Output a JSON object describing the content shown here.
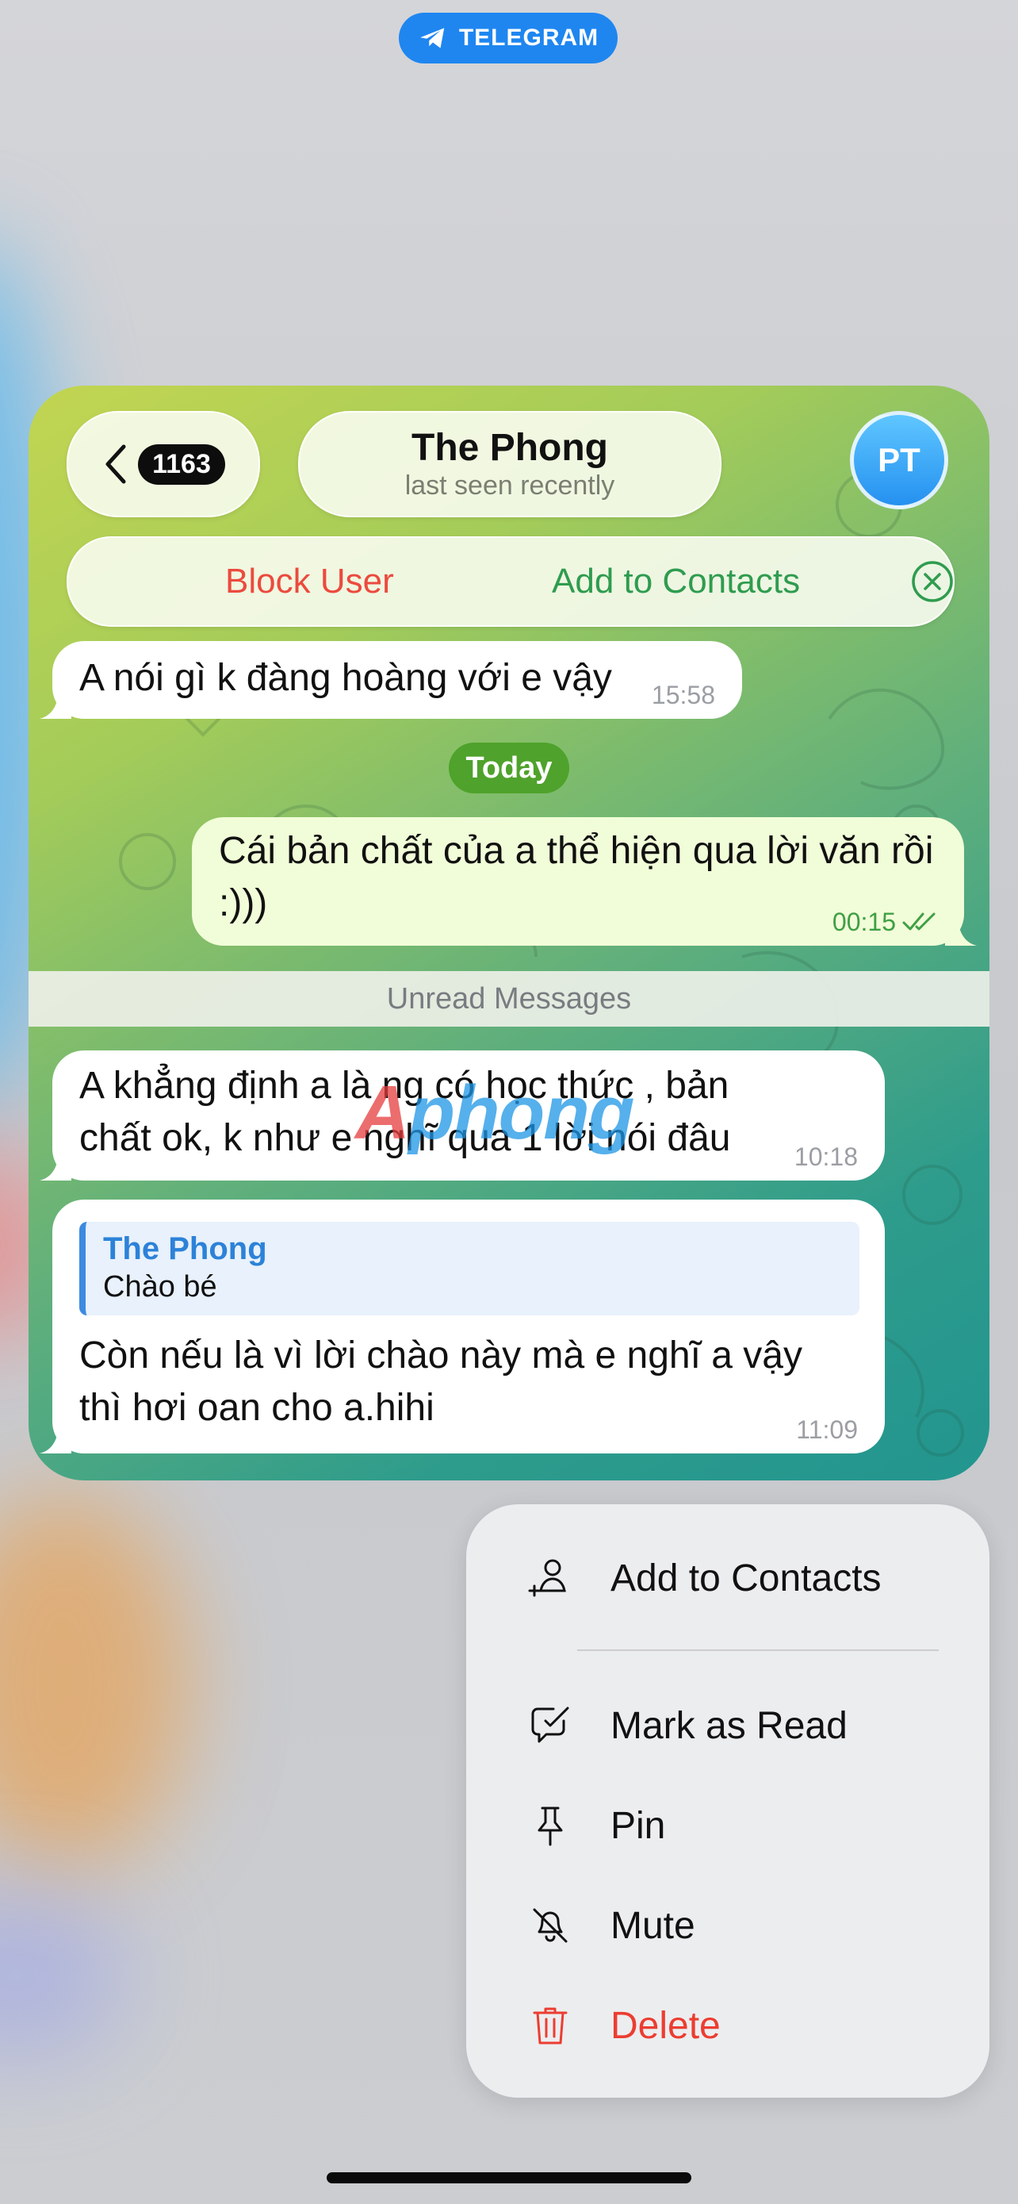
{
  "app_badge": {
    "label": "TELEGRAM",
    "icon": "telegram-plane-icon"
  },
  "header": {
    "back_count": "1163",
    "contact_name": "The Phong",
    "status": "last seen recently",
    "avatar_initials": "PT"
  },
  "action_bar": {
    "block_label": "Block User",
    "add_label": "Add to Contacts",
    "close_icon": "close-circle-icon"
  },
  "messages": [
    {
      "direction": "in",
      "text": "A nói gì k đàng hoàng với e vậy",
      "time": "15:58"
    },
    {
      "direction": "out",
      "text": "Cái bản chất của a thể hiện qua lời văn rồi :)))",
      "time": "00:15"
    },
    {
      "direction": "in",
      "text": "A khẳng định a là ng có học thức , bản chất ok, k như e nghĩ qua 1 lời nói đâu",
      "time": "10:18"
    },
    {
      "direction": "in",
      "reply_name": "The Phong",
      "reply_text": "Chào bé",
      "text": "Còn nếu là vì lời chào này mà e nghĩ a vậy thì hơi oan cho a.hihi",
      "time": "11:09"
    }
  ],
  "date_divider": "Today",
  "unread_label": "Unread Messages",
  "watermark": {
    "part1": "A",
    "part2": "phong"
  },
  "menu": {
    "items": [
      {
        "label": "Add to Contacts",
        "icon": "add-person-icon"
      },
      {
        "label": "Mark as Read",
        "icon": "chat-check-icon"
      },
      {
        "label": "Pin",
        "icon": "pin-icon"
      },
      {
        "label": "Mute",
        "icon": "bell-slash-icon"
      },
      {
        "label": "Delete",
        "icon": "trash-icon"
      }
    ]
  },
  "colors": {
    "accent_blue": "#1f86f0",
    "block_red": "#ec4a3e",
    "add_green": "#2f9c4f",
    "outgoing_bubble": "#f1fdd8",
    "date_pill": "#4fa22b",
    "delete_red": "#ec3d31"
  }
}
